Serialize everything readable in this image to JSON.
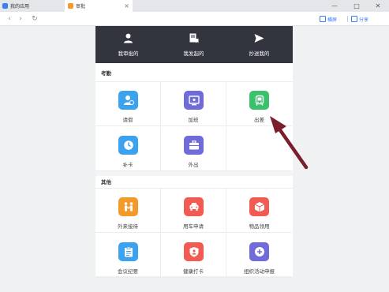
{
  "tabs": [
    {
      "label": "我的应用",
      "icon": "app-icon"
    },
    {
      "label": "审批",
      "icon": "approval-icon"
    }
  ],
  "window_controls": {
    "minimize": "—",
    "maximize": "□",
    "close": "✕"
  },
  "toolbar": {
    "back": "‹",
    "forward": "›",
    "reload": "↻",
    "landscape_label": "横屏",
    "share_label": "分享"
  },
  "header": {
    "items": [
      {
        "label": "我审批的",
        "icon": "person-icon"
      },
      {
        "label": "我发起的",
        "icon": "document-flag-icon"
      },
      {
        "label": "抄送我的",
        "icon": "send-icon"
      }
    ]
  },
  "attendance": {
    "title": "考勤",
    "items": [
      {
        "label": "请假",
        "icon": "leave-icon",
        "color": "#3ba2f0"
      },
      {
        "label": "加班",
        "icon": "overtime-icon",
        "color": "#6f6bd9"
      },
      {
        "label": "出差",
        "icon": "business-trip-icon",
        "color": "#3bc16c"
      },
      {
        "label": "补卡",
        "icon": "clock-icon",
        "color": "#3ba2f0"
      },
      {
        "label": "外出",
        "icon": "briefcase-icon",
        "color": "#6f6bd9"
      }
    ]
  },
  "other": {
    "title": "其他",
    "items": [
      {
        "label": "外来接待",
        "icon": "reception-icon",
        "color": "#f39a2b"
      },
      {
        "label": "用车申请",
        "icon": "car-icon",
        "color": "#f25b52"
      },
      {
        "label": "物品领用",
        "icon": "package-icon",
        "color": "#f25b52"
      },
      {
        "label": "会议纪要",
        "icon": "clipboard-icon",
        "color": "#3ba2f0"
      },
      {
        "label": "健康打卡",
        "icon": "health-icon",
        "color": "#f25b52"
      },
      {
        "label": "组织活动申报",
        "icon": "plus-icon",
        "color": "#6f6bd9"
      }
    ]
  },
  "annotation": {
    "arrow_color": "#7a1e2c"
  }
}
